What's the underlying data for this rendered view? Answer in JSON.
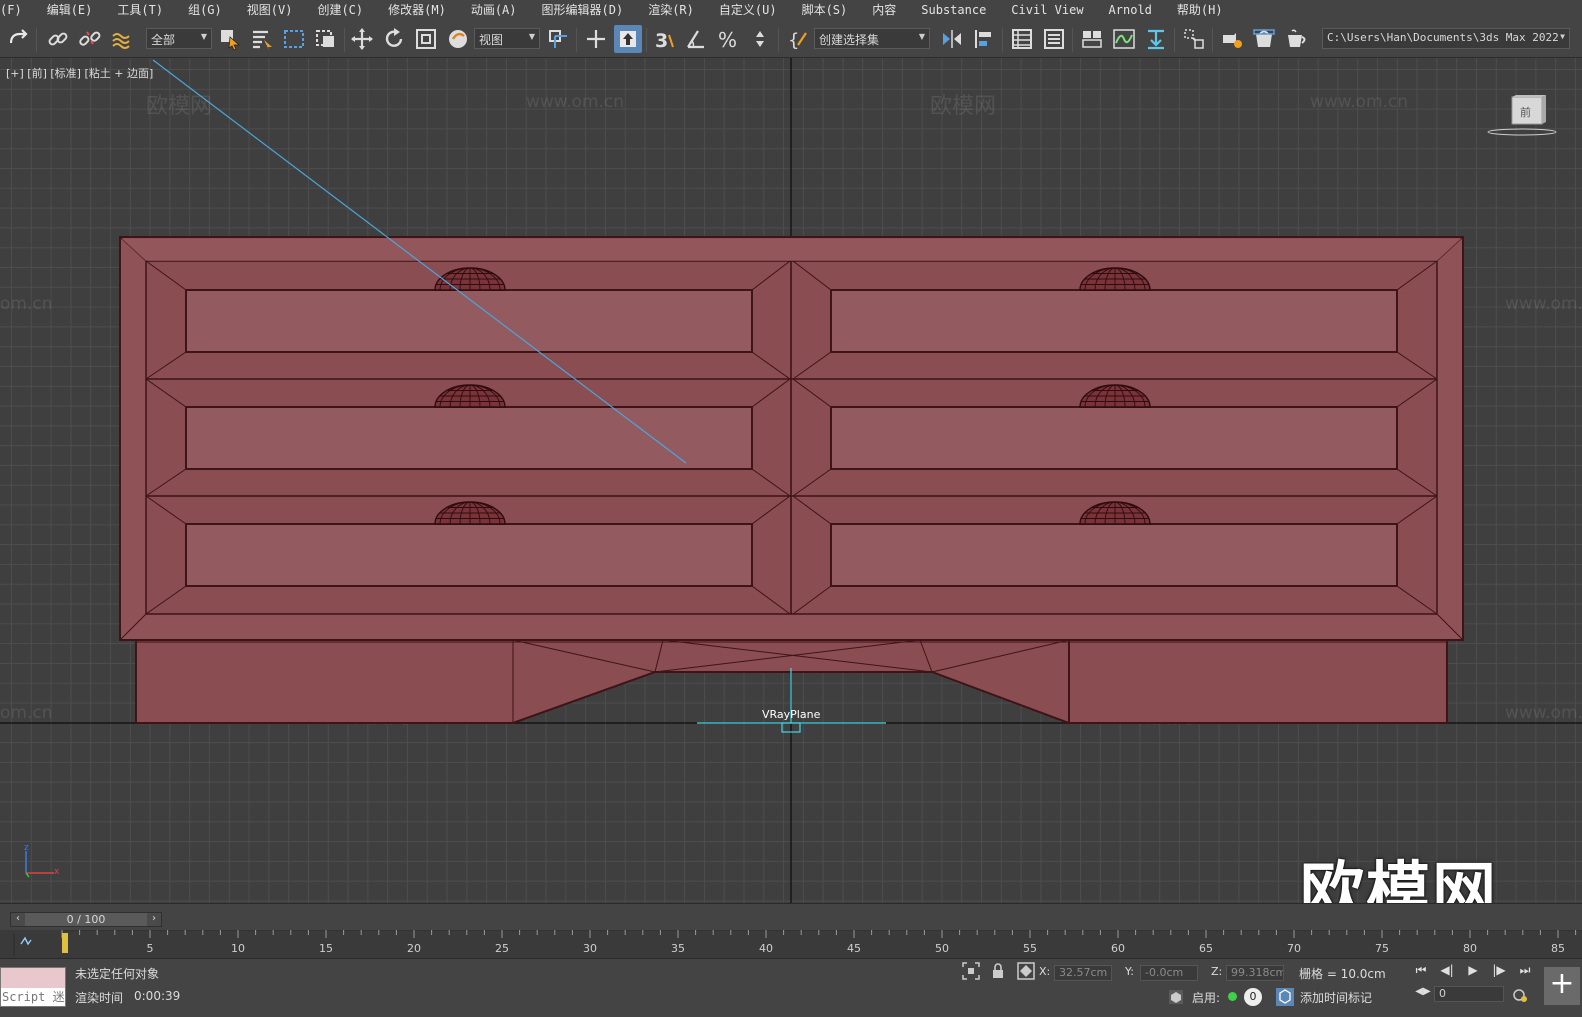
{
  "menu": [
    "(F)",
    "编辑(E)",
    "工具(T)",
    "组(G)",
    "视图(V)",
    "创建(C)",
    "修改器(M)",
    "动画(A)",
    "图形编辑器(D)",
    "渲染(R)",
    "自定义(U)",
    "脚本(S)",
    "内容",
    "Substance",
    "Civil View",
    "Arnold",
    "帮助(H)"
  ],
  "toolbar": {
    "filter_label": "全部",
    "ref_coord_label": "视图",
    "selection_set_label": "创建选择集",
    "project_path": "C:\\Users\\Han\\Documents\\3ds Max 2022"
  },
  "viewport": {
    "label": "[+] [前] [标准] [粘土 + 边面]",
    "object_label": "VRayPlane",
    "viewcube_label": "前",
    "watermark_text": "欧模网",
    "watermark_url": "www.om.cn",
    "watermark_partial": "om.cn",
    "watermark_big": "欧模网",
    "axis_z": "z",
    "axis_x": "x"
  },
  "timeline": {
    "slider_text": "0 / 100",
    "ticks": [
      "5",
      "10",
      "15",
      "20",
      "25",
      "30",
      "35",
      "40",
      "45",
      "50",
      "55",
      "60",
      "65",
      "70",
      "75",
      "80",
      "85"
    ]
  },
  "status": {
    "maxscript_label": "Script 迷",
    "selection_status": "未选定任何对象",
    "render_time_label": "渲染时间",
    "render_time_value": "0:00:39",
    "x_label": "X:",
    "x_value": "32.57cm",
    "y_label": "Y:",
    "y_value": "-0.0cm",
    "z_label": "Z:",
    "z_value": "99.318cm",
    "grid_label": "栅格 = 10.0cm",
    "enable_label": "启用:",
    "enable_value": "0",
    "add_time_tag": "添加时间标记",
    "frame_value": "0"
  },
  "colors": {
    "cabinet_fill": "#8e5257",
    "cabinet_edge": "#3e1416",
    "viewport_bg": "#3f3f3f",
    "active_tool": "#5b87b6"
  }
}
